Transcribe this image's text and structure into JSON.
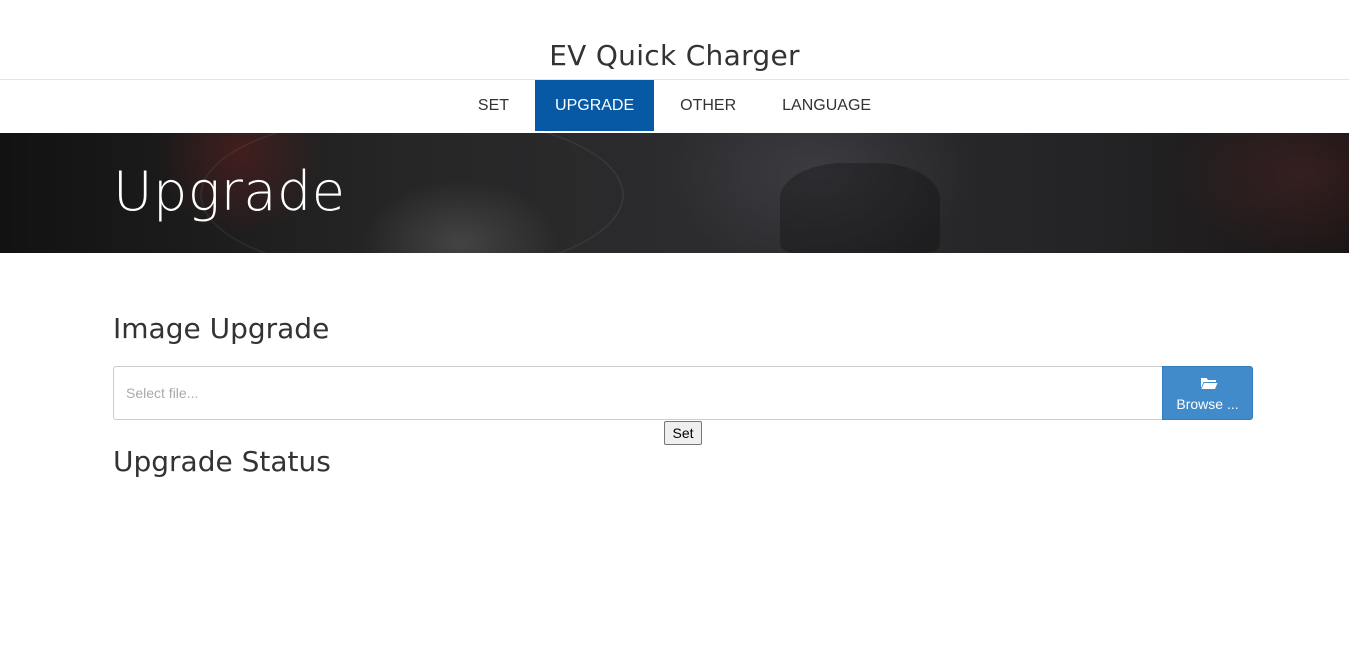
{
  "header": {
    "site_title": "EV Quick Charger"
  },
  "nav": {
    "items": [
      {
        "label": "SET",
        "active": false
      },
      {
        "label": "UPGRADE",
        "active": true
      },
      {
        "label": "OTHER",
        "active": false
      },
      {
        "label": "LANGUAGE",
        "active": false
      }
    ]
  },
  "banner": {
    "title": "Upgrade"
  },
  "image_upgrade": {
    "heading": "Image Upgrade",
    "file_input_placeholder": "Select file...",
    "browse_label": "Browse ...",
    "browse_icon": "folder-open-icon",
    "set_label": "Set"
  },
  "upgrade_status": {
    "heading": "Upgrade Status"
  },
  "colors": {
    "nav_active_bg": "#0759a6",
    "browse_button_bg": "#428bca"
  }
}
